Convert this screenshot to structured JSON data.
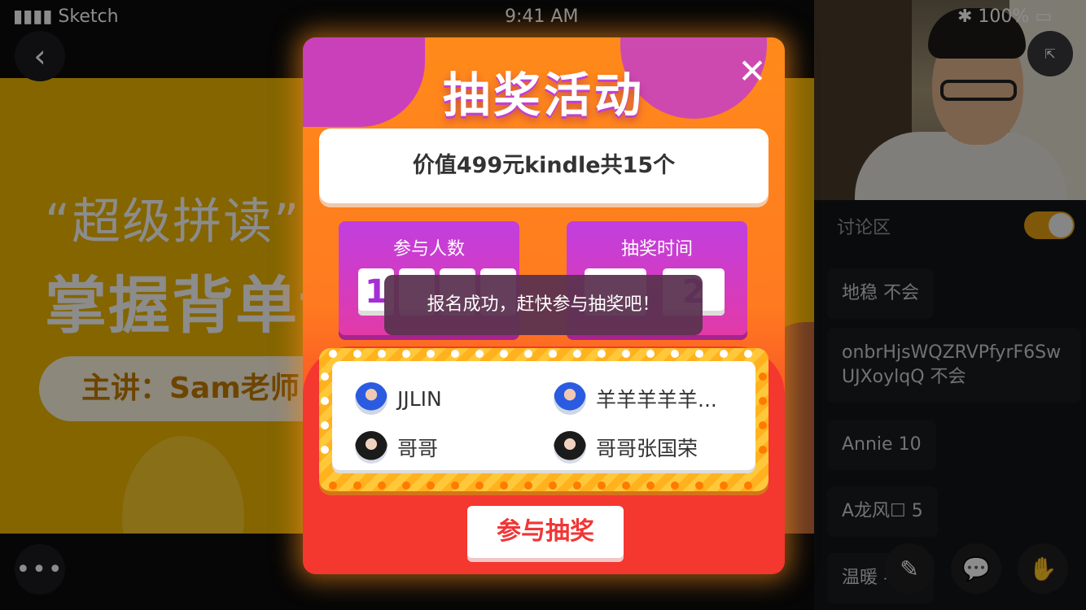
{
  "status_bar": {
    "signal": "▮▮▮▮ Sketch",
    "time": "9:41 AM",
    "battery": "✱ 100% ▭"
  },
  "slide": {
    "subtitle": "“超级拼读”",
    "title": "掌握背单词",
    "speaker": "主讲：Sam老师"
  },
  "buttons": {
    "back": "‹",
    "more": "•••",
    "share": "⇱",
    "edit": "✎",
    "comment": "💬",
    "hand": "✋"
  },
  "chat": {
    "title": "讨论区",
    "toggle_on": true,
    "messages": [
      {
        "text": "地稳 不会"
      },
      {
        "text": "onbrHjsWQZRVPfyrF6SwUJXoylqQ 不会"
      },
      {
        "text": "Annie 10"
      },
      {
        "text": "A龙风☐ 5"
      },
      {
        "text": "温暖 不会"
      }
    ]
  },
  "modal": {
    "title": "抽奖活动",
    "close": "✕",
    "prize": "价值499元kindle共15个",
    "participants_label": "参与人数",
    "participants_digits": [
      "1",
      "",
      "",
      ""
    ],
    "draw_time_label": "抽奖时间",
    "draw_time_digits": [
      "",
      "2"
    ],
    "toast": "报名成功，赶快参与抽奖吧！",
    "winners": [
      {
        "name": "JJLIN",
        "avatar": "avatar-a"
      },
      {
        "name": "羊羊羊羊羊...",
        "avatar": "avatar-a"
      },
      {
        "name": "哥哥",
        "avatar": "avatar-b"
      },
      {
        "name": "哥哥张国荣",
        "avatar": "avatar-b"
      }
    ],
    "join_button": "参与抽奖"
  },
  "colors": {
    "accent": "#ff8a1a",
    "brand_purple": "#c13ee0",
    "toggle": "#e8a013",
    "join_text": "#f23535"
  }
}
